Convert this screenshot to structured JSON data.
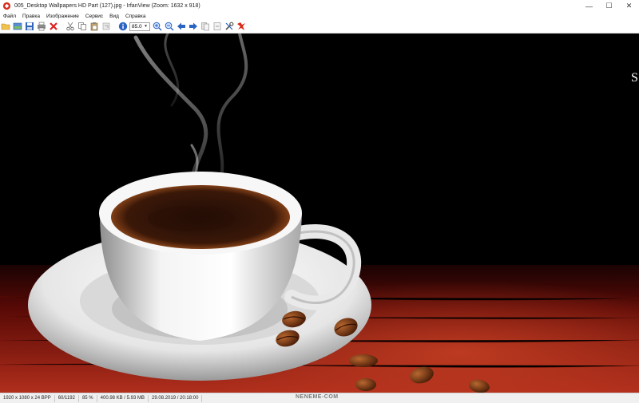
{
  "window": {
    "title": "005_Desktop Wallpapers  HD Part (127).jpg - IrfanView (Zoom: 1632 x 918)",
    "controls": {
      "minimize": "—",
      "maximize": "☐",
      "close": "✕"
    }
  },
  "menu": {
    "items": [
      "Файл",
      "Правка",
      "Изображение",
      "Сервис",
      "Вид",
      "Справка"
    ]
  },
  "toolbar": {
    "zoom_value": "85.0",
    "icons": [
      "open-folder-icon",
      "thumbnails-icon",
      "save-icon",
      "print-icon",
      "delete-icon",
      "cut-icon",
      "copy-icon",
      "paste-icon",
      "undo-icon",
      "info-icon",
      "zoom-in-icon",
      "zoom-out-icon",
      "previous-icon",
      "next-icon",
      "copy-file-icon",
      "move-file-icon",
      "settings-icon",
      "irfanview-logo-icon"
    ]
  },
  "canvas": {
    "image_corner_text": "S"
  },
  "status": {
    "dimensions": "1920 x 1080 x 24 BPP",
    "index": "60/1192",
    "zoom": "85 %",
    "size": "400.98 KB / 5.93 MB",
    "datetime": "29.08.2019 / 20:18:00"
  },
  "watermark": "NENEME-COM"
}
